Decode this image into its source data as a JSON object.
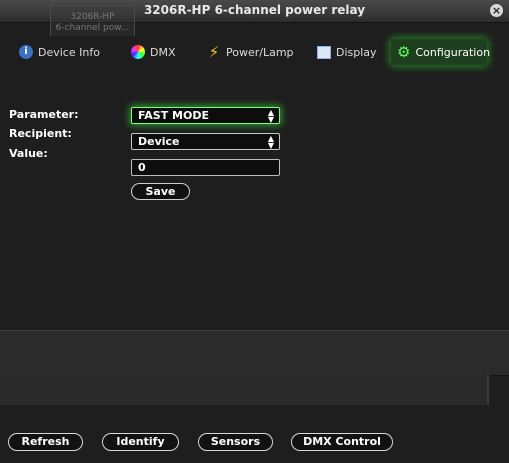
{
  "window": {
    "title": "3206R-HP 6-channel power relay",
    "close_glyph": "×"
  },
  "ghost_card": {
    "line1": "3206R-HP",
    "line2": "6-channel pow..."
  },
  "tabs": [
    {
      "label": "Device Info",
      "icon": "info-icon",
      "active": false
    },
    {
      "label": "DMX",
      "icon": "color-wheel-icon",
      "active": false
    },
    {
      "label": "Power/Lamp",
      "icon": "lightning-icon",
      "active": false
    },
    {
      "label": "Display",
      "icon": "display-icon",
      "active": false
    },
    {
      "label": "Configuration",
      "icon": "gear-icon",
      "active": true
    }
  ],
  "form": {
    "parameter_label": "Parameter:",
    "parameter_value": "FAST MODE",
    "recipient_label": "Recipient:",
    "recipient_value": "Device",
    "value_label": "Value:",
    "value_value": "0",
    "save_label": "Save"
  },
  "footer": {
    "refresh_label": "Refresh",
    "identify_label": "Identify",
    "sensors_label": "Sensors",
    "dmx_control_label": "DMX Control"
  },
  "colors": {
    "accent": "#3ccc3c",
    "background": "#1e1e1e"
  }
}
